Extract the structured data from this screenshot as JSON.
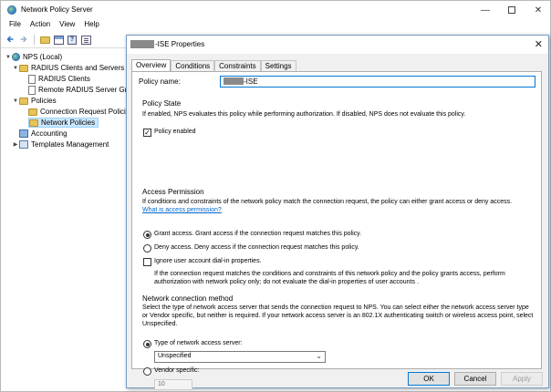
{
  "app": {
    "title": "Network Policy Server"
  },
  "menu": [
    "File",
    "Action",
    "View",
    "Help"
  ],
  "tree": {
    "root": "NPS (Local)",
    "radius_clients_servers": "RADIUS Clients and Servers",
    "radius_clients": "RADIUS Clients",
    "remote_groups": "Remote RADIUS Server Grou",
    "policies": "Policies",
    "connection_request": "Connection Request Policie",
    "network_policies": "Network Policies",
    "accounting": "Accounting",
    "templates": "Templates Management"
  },
  "dialog": {
    "title_suffix": "-ISE Properties",
    "tabs": [
      "Overview",
      "Conditions",
      "Constraints",
      "Settings"
    ],
    "policy_name_label": "Policy name:",
    "policy_name_value": "-ISE",
    "policy_state": {
      "title": "Policy State",
      "desc": "If enabled, NPS evaluates this policy while performing authorization. If disabled, NPS does not evaluate this policy.",
      "enabled_label": "Policy enabled",
      "enabled": true
    },
    "access_permission": {
      "title": "Access Permission",
      "desc": "If conditions and constraints of the network policy match the connection request, the policy can either grant access or deny access.",
      "link": "What is access permission?",
      "grant": "Grant access. Grant access if the connection request matches this policy.",
      "deny": "Deny access. Deny access if the connection request matches this policy.",
      "ignore": "Ignore user account dial-in properties.",
      "ignore_desc": "If the connection request matches the conditions and constraints of this network policy and the policy grants access, perform authorization with network policy only; do not evaluate the dial-in properties of user accounts ."
    },
    "network_connection": {
      "title": "Network connection method",
      "desc": "Select the type of network access server that sends the connection request to NPS. You can select either the network access server type or Vendor specific, but neither is required.  If your network access server is an 802.1X authenticating switch or wireless access point, select Unspecified.",
      "type_label": "Type of network access server:",
      "type_value": "Unspecified",
      "vendor_label": "Vendor specific:",
      "vendor_value": "10"
    },
    "buttons": {
      "ok": "OK",
      "cancel": "Cancel",
      "apply": "Apply"
    }
  },
  "colors": {
    "accent": "#0078d7",
    "link": "#0066cc",
    "selection": "#cce8ff"
  }
}
